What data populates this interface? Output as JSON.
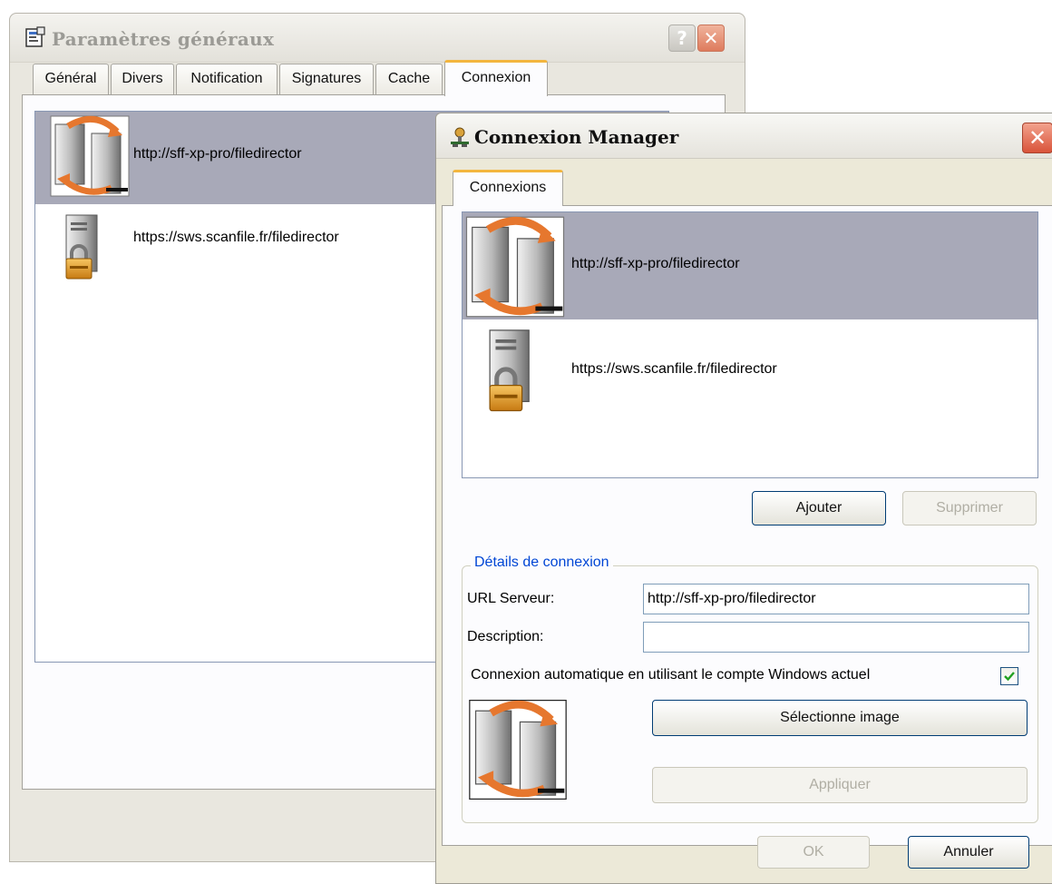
{
  "params_window": {
    "title": "Paramètres généraux",
    "help_glyph": "?",
    "close_glyph": "✕",
    "tabs": [
      "Général",
      "Divers",
      "Notification",
      "Signatures",
      "Cache",
      "Connexion"
    ],
    "active_tab": "Connexion",
    "connections": [
      {
        "url": "http://sff-xp-pro/filedirector",
        "icon": "server-sync-icon",
        "selected": true
      },
      {
        "url": "https://sws.scanfile.fr/filedirector",
        "icon": "secure-server-icon",
        "selected": false
      }
    ]
  },
  "manager_window": {
    "title": "Connexion Manager",
    "close_glyph": "✕",
    "tab": "Connexions",
    "connections": [
      {
        "url": "http://sff-xp-pro/filedirector",
        "icon": "server-sync-icon",
        "selected": true
      },
      {
        "url": "https://sws.scanfile.fr/filedirector",
        "icon": "secure-server-icon",
        "selected": false
      }
    ],
    "add_button": "Ajouter",
    "delete_button": "Supprimer",
    "details": {
      "legend": "Détails de connexion",
      "url_label": "URL Serveur:",
      "url_value": "http://sff-xp-pro/filedirector",
      "description_label": "Description:",
      "description_value": "",
      "auto_login_label": "Connexion automatique en utilisant le compte Windows actuel",
      "auto_login_checked": true,
      "preview_icon": "server-sync-icon",
      "select_image_button": "Sélectionne image",
      "apply_button": "Appliquer"
    },
    "ok_button": "OK",
    "cancel_button": "Annuler"
  },
  "colors": {
    "selection": "#a8a9b8",
    "tab_highlight": "#f3b63f",
    "group_legend": "#0046d5",
    "checkbox_mark": "#21a121",
    "close_button": "#d9533a"
  }
}
